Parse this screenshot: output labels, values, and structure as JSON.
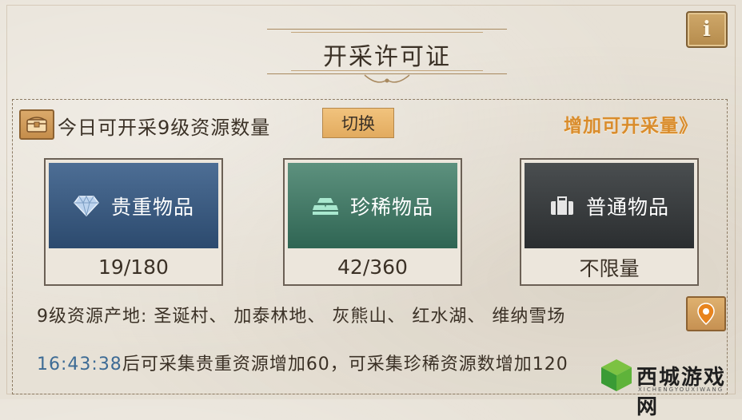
{
  "header": {
    "title": "开采许可证",
    "info_icon": "info-icon",
    "info_label": "i"
  },
  "section": {
    "icon": "chest-icon",
    "label": "今日可开采9级资源数量",
    "switch_label": "切换",
    "increase_link": "增加可开采量》"
  },
  "cards": [
    {
      "icon": "diamond-icon",
      "label": "贵重物品",
      "count": "19/180"
    },
    {
      "icon": "gold-bars-icon",
      "label": "珍稀物品",
      "count": "42/360"
    },
    {
      "icon": "suitcase-icon",
      "label": "普通物品",
      "count": "不限量"
    }
  ],
  "origin": {
    "text": "9级资源产地: 圣诞村、 加泰林地、 灰熊山、 红水湖、 维纳雪场",
    "location_icon": "location-pin-icon"
  },
  "timer_row": {
    "time": "16:43:38",
    "message": "后可采集贵重资源增加60，可采集珍稀资源数增加120"
  },
  "watermark": {
    "text": "西城游戏网",
    "sub": "XICHENGYOUXIWANG"
  },
  "colors": {
    "background": "#e7e1d6",
    "accent_orange": "#d98c2c",
    "timer_blue": "#3d6b95",
    "precious_blue": "#2c4a6e",
    "rare_green": "#2f6553",
    "common_dark": "#2b2e30"
  }
}
